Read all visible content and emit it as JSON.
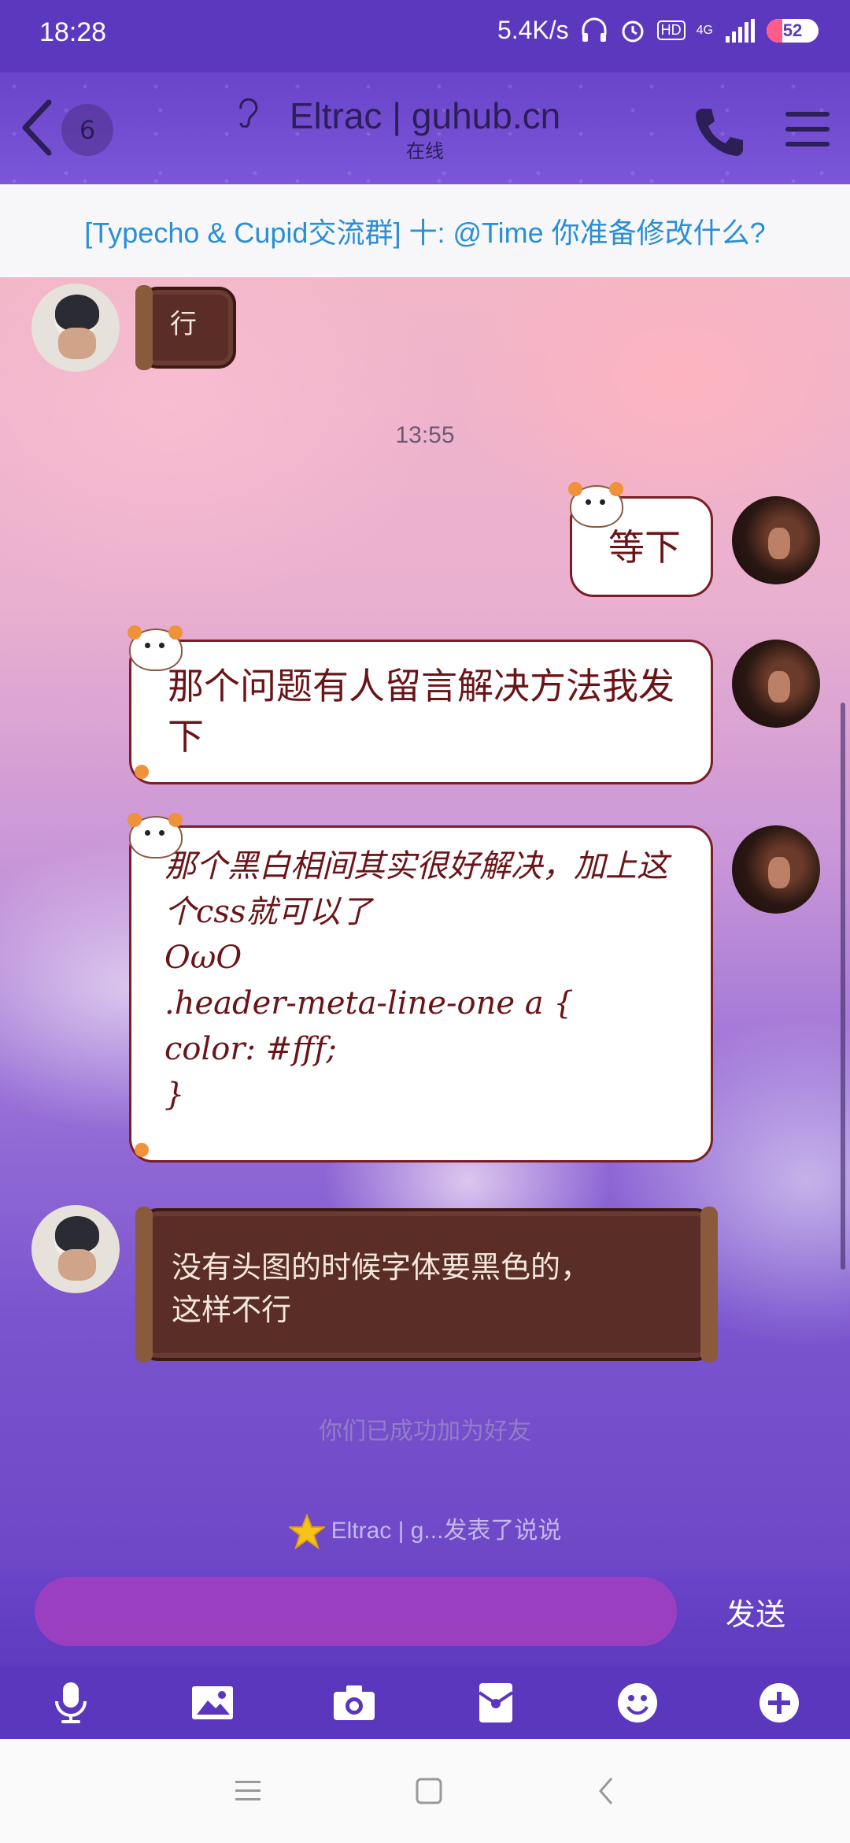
{
  "status_bar": {
    "time": "18:28",
    "net_speed": "5.4K/s",
    "signal": "4G",
    "hd": "HD",
    "battery": "52"
  },
  "header": {
    "unread_count": "6",
    "title": "Eltrac | guhub.cn",
    "online_status": "在线"
  },
  "pinned": {
    "text": "[Typecho & Cupid交流群] 十: @Time 你准备修改什么?"
  },
  "chat": {
    "time_separator": "13:55",
    "messages": [
      {
        "side": "other",
        "style": "brown",
        "text": "行"
      },
      {
        "side": "self",
        "style": "white",
        "text": "等下"
      },
      {
        "side": "self",
        "style": "white",
        "text": "那个问题有人留言解决方法我发下"
      },
      {
        "side": "self",
        "style": "white",
        "text": "那个黑白相间其实很好解决，加上这个css就可以了\nOωO\n.header-meta-line-one a {\ncolor: #fff;\n}"
      },
      {
        "side": "other",
        "style": "brown",
        "text": "没有头图的时候字体要黑色的，\n这样不行"
      }
    ],
    "system_tip": "你们已成功加为好友",
    "feed_tip": "Eltrac | g...发表了说说"
  },
  "input": {
    "placeholder": "",
    "send_label": "发送"
  },
  "toolbar": {
    "items": [
      "microphone-icon",
      "image-icon",
      "camera-icon",
      "red-packet-icon",
      "emoji-icon",
      "plus-icon"
    ]
  },
  "colors": {
    "accent": "#5c38bf",
    "pinned_text": "#2a8fd6",
    "input_bg": "#9a3fc0",
    "bubble_border": "#7a1d24",
    "bubble_brown": "#5a2d26"
  }
}
